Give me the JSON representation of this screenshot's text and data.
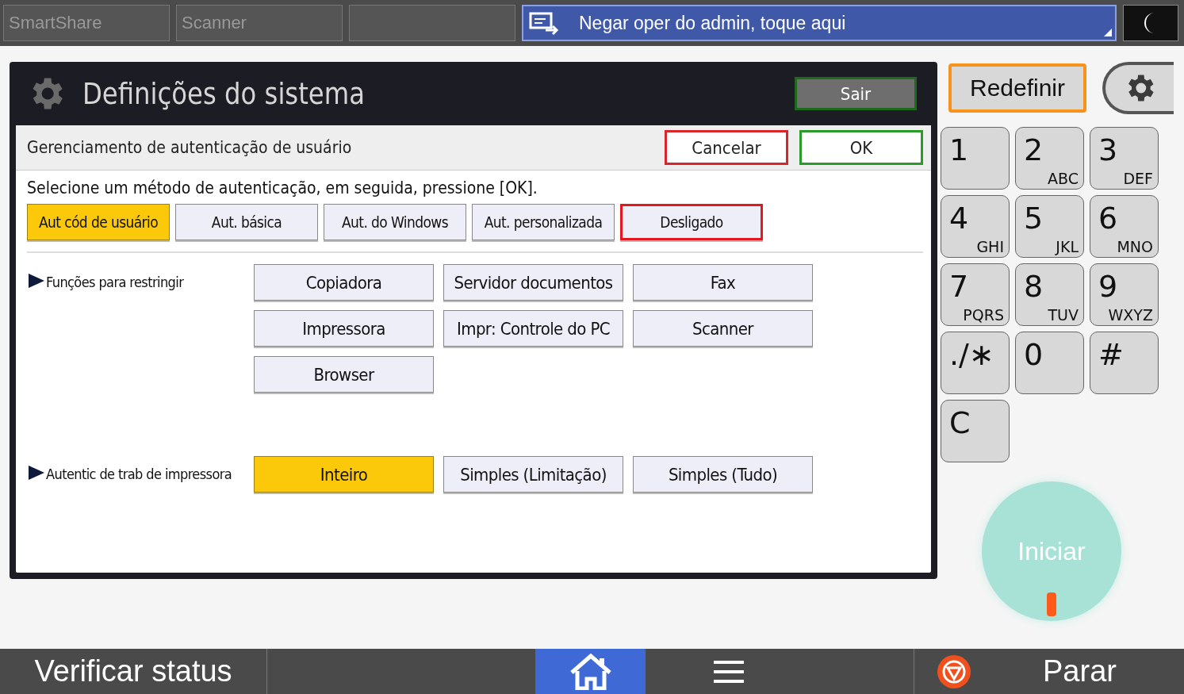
{
  "top_bar": {
    "tabs": [
      {
        "label": "SmartShare"
      },
      {
        "label": "Scanner"
      }
    ],
    "banner": {
      "text": "Negar oper do admin, toque aqui"
    }
  },
  "dialog": {
    "title": "Definições do sistema",
    "exit_button": "Sair",
    "subtitle": "Gerenciamento de autenticação de usuário",
    "cancel_button": "Cancelar",
    "ok_button": "OK",
    "instruction": "Selecione um método de autenticação, em seguida, pressione [OK].",
    "methods": [
      {
        "label": "Aut cód de usuário",
        "selected": true,
        "current": false
      },
      {
        "label": "Aut. básica",
        "selected": false,
        "current": false
      },
      {
        "label": "Aut. do Windows",
        "selected": false,
        "current": false
      },
      {
        "label": "Aut. personalizada",
        "selected": false,
        "current": false
      },
      {
        "label": "Desligado",
        "selected": false,
        "current": true
      }
    ],
    "sections": [
      {
        "label": "Funções para restringir",
        "options": [
          {
            "label": "Copiadora",
            "selected": false
          },
          {
            "label": "Servidor documentos",
            "selected": false
          },
          {
            "label": "Fax",
            "selected": false
          },
          {
            "label": "Impressora",
            "selected": false
          },
          {
            "label": "Impr: Controle do PC",
            "selected": false
          },
          {
            "label": "Scanner",
            "selected": false
          },
          {
            "label": "Browser",
            "selected": false
          }
        ]
      },
      {
        "label": "Autentic de trab de impressora",
        "options": [
          {
            "label": "Inteiro",
            "selected": true
          },
          {
            "label": "Simples (Limitação)",
            "selected": false
          },
          {
            "label": "Simples (Tudo)",
            "selected": false
          }
        ]
      }
    ]
  },
  "side": {
    "reset_button": "Redefinir",
    "keys": [
      {
        "digit": "1"
      },
      {
        "digit": "2",
        "letters": "ABC"
      },
      {
        "digit": "3",
        "letters": "DEF"
      },
      {
        "digit": "4",
        "letters": "GHI"
      },
      {
        "digit": "5",
        "letters": "JKL"
      },
      {
        "digit": "6",
        "letters": "MNO"
      },
      {
        "digit": "7",
        "letters": "PQRS"
      },
      {
        "digit": "8",
        "letters": "TUV"
      },
      {
        "digit": "9",
        "letters": "WXYZ"
      },
      {
        "digit": "./∗"
      },
      {
        "digit": "0"
      },
      {
        "digit": "#"
      },
      {
        "digit": "C"
      }
    ],
    "start_button": "Iniciar"
  },
  "bottom_bar": {
    "status_button": "Verificar status",
    "stop_button": "Parar"
  }
}
